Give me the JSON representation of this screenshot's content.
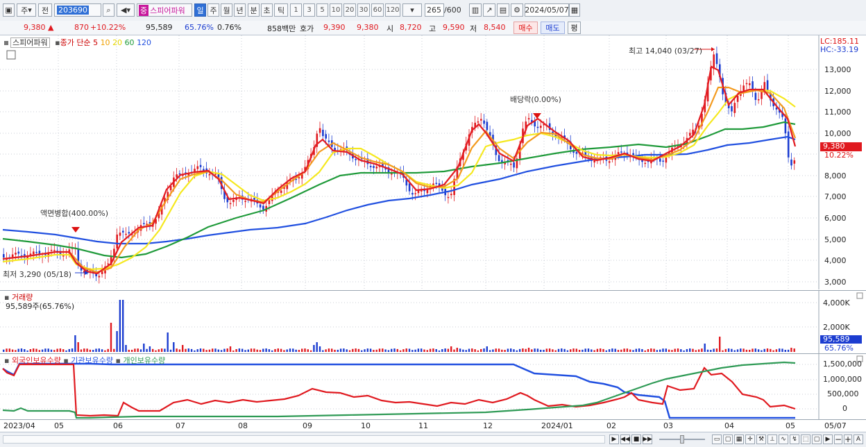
{
  "toolbar": {
    "market_label": "주",
    "prev_label": "전",
    "code": "203690",
    "search_icon": "magnifier-icon",
    "speaker_icon": "speaker-icon",
    "name_prefix": "중",
    "stock_name": "스피어파워",
    "periods": [
      "일",
      "주",
      "월",
      "년",
      "분",
      "초",
      "틱"
    ],
    "selected_period": "일",
    "numbers": [
      "1",
      "3",
      "5",
      "10",
      "20",
      "30",
      "60",
      "120"
    ],
    "count_value": "265",
    "count_total": "/600",
    "date": "2024/05/07"
  },
  "quote": {
    "price": "9,380",
    "change": "870",
    "change_pct": "+10.22%",
    "volume": "95,589",
    "vol_ratio": "65.76%",
    "turnover": "0.76%",
    "amount": "858백만",
    "ask_label": "호가",
    "ask": "9,390",
    "bid": "9,380",
    "open_label": "시",
    "open": "8,720",
    "high_label": "고",
    "high": "9,590",
    "low_label": "저",
    "low": "8,540",
    "buy_label": "매수",
    "sell_label": "매도",
    "avg_label": "평"
  },
  "price_panel": {
    "stock": "스피어파워",
    "legend_prefix": "종가 단순",
    "ma_labels": [
      "5",
      "10",
      "20",
      "60",
      "120"
    ],
    "ma_colors": [
      "#e31e24",
      "#f39a1e",
      "#f5e81f",
      "#1f9a3a",
      "#2150e0"
    ],
    "lc": "LC:185.11",
    "hc": "HC:-33.19",
    "y_ticks": [
      "13,000",
      "12,000",
      "11,000",
      "10,000",
      "9,000",
      "8,000",
      "7,000",
      "6,000",
      "5,000",
      "4,000",
      "3,000"
    ],
    "current_price": "9,380",
    "current_pct": "10.22%",
    "ann_high": "최고 14,040 (03/27)",
    "ann_low": "최저 3,290 (05/18)",
    "ann_split": "액면병합(400.00%)",
    "ann_div": "배당락(0.00%)"
  },
  "volume_panel": {
    "title": "거래량",
    "value": "95,589주(65.76%)",
    "y_ticks": [
      "4,000K",
      "2,000K"
    ],
    "current": "95,589",
    "current_pct": "65.76%"
  },
  "holdings_panel": {
    "legend": [
      "외국인보유수량",
      "기관보유수량",
      "개인보유수량"
    ],
    "legend_colors": [
      "#e0191f",
      "#2150e0",
      "#2e9a55"
    ],
    "y_ticks": [
      "1,500,000",
      "1,000,000",
      "500,000",
      "0"
    ]
  },
  "x_axis": [
    "2023/04",
    "05",
    "06",
    "07",
    "08",
    "09",
    "10",
    "11",
    "12",
    "2024/01",
    "02",
    "03",
    "04",
    "05",
    "05/07"
  ],
  "colors": {
    "up": "#e0191f",
    "down": "#1b3cd0",
    "accent": "#2f6fd6"
  }
}
